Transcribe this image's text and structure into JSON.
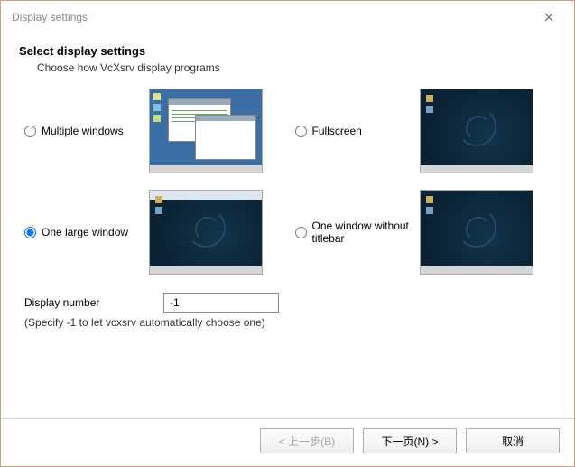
{
  "window": {
    "title": "Display settings"
  },
  "header": {
    "heading": "Select display settings",
    "subheading": "Choose how VcXsrv display programs"
  },
  "options": {
    "multiple_windows": {
      "label": "Multiple windows",
      "selected": false
    },
    "fullscreen": {
      "label": "Fullscreen",
      "selected": false
    },
    "one_large_window": {
      "label": "One large window",
      "selected": true
    },
    "no_titlebar": {
      "label": "One window without titlebar",
      "selected": false
    }
  },
  "display_number": {
    "label": "Display number",
    "value": "-1",
    "hint": "(Specify -1 to let vcxsrv automatically choose one)"
  },
  "footer": {
    "back": "< 上一步(B)",
    "next": "下一页(N) >",
    "cancel": "取消"
  }
}
